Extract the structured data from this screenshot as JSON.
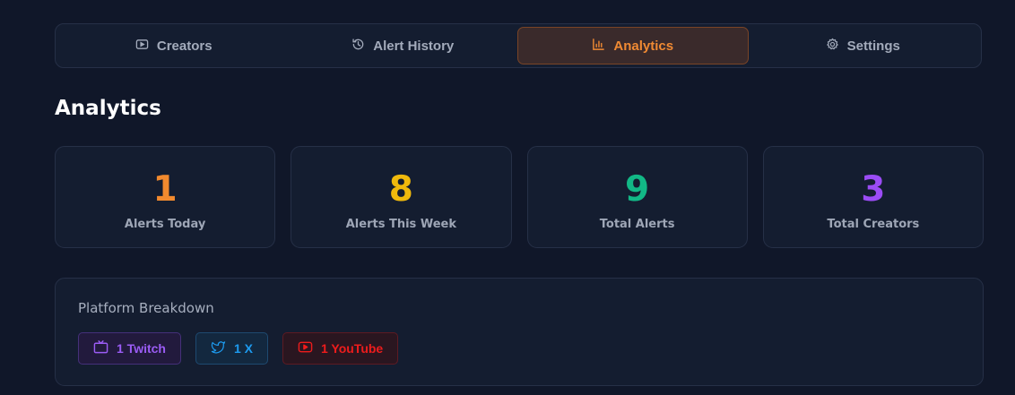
{
  "tabs": [
    {
      "label": "Creators",
      "icon": "play-icon",
      "active": false
    },
    {
      "label": "Alert History",
      "icon": "history-icon",
      "active": false
    },
    {
      "label": "Analytics",
      "icon": "bar-chart-icon",
      "active": true
    },
    {
      "label": "Settings",
      "icon": "gear-icon",
      "active": false
    }
  ],
  "title": "Analytics",
  "stats": [
    {
      "value": "1",
      "label": "Alerts Today",
      "color": "#f28a2e"
    },
    {
      "value": "8",
      "label": "Alerts This Week",
      "color": "#f0b90c"
    },
    {
      "value": "9",
      "label": "Total Alerts",
      "color": "#12b886"
    },
    {
      "value": "3",
      "label": "Total Creators",
      "color": "#9b4cf5"
    }
  ],
  "breakdown": {
    "title": "Platform Breakdown",
    "platforms": [
      {
        "label": "1 Twitch",
        "icon": "tv-icon",
        "color": "#9b5cf5"
      },
      {
        "label": "1 X",
        "icon": "bird-icon",
        "color": "#1d9bf0"
      },
      {
        "label": "1 YouTube",
        "icon": "youtube-icon",
        "color": "#ee1c1c"
      }
    ]
  }
}
